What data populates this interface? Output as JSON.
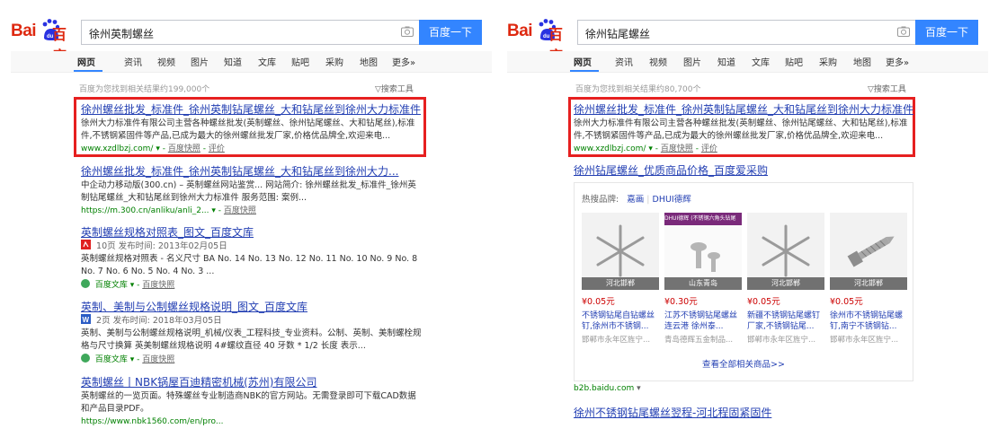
{
  "left": {
    "logo": {
      "text1": "Bai",
      "text2": "百度"
    },
    "search": {
      "query": "徐州英制螺丝",
      "button": "百度一下"
    },
    "nav": [
      "网页",
      "资讯",
      "视频",
      "图片",
      "知道",
      "文库",
      "贴吧",
      "采购",
      "地图",
      "更多»"
    ],
    "stats": "百度为您找到相关结果约199,000个",
    "tools": "搜索工具",
    "results": [
      {
        "title": "徐州螺丝批发_标准件_徐州英制钻尾螺丝_大和钻尾丝到徐州大力标准件",
        "desc": "徐州大力标准件有限公司主营各种螺丝批发(英制螺丝、徐州钻尾螺丝、大和钻尾丝),标准件,不锈钢紧固件等产品,已成为最大的徐州螺丝批发厂家,价格优品牌全,欢迎来电...",
        "url": "www.xzdlbzj.com/",
        "cache": "百度快照",
        "review": "评价"
      },
      {
        "title": "徐州螺丝批发_标准件_徐州英制钻尾螺丝_大和钻尾丝到徐州大力...",
        "desc": "中企动力移动版(300.cn) – 英制螺丝网站鉴赏... 网站简介: 徐州螺丝批发_标准件_徐州英制钻尾螺丝_大和钻尾丝到徐州大力标准件 服务范围: 案例...",
        "url": "https://m.300.cn/anliku/anli_2...",
        "cache": "百度快照"
      },
      {
        "title": "英制螺丝规格对照表_图文_百度文库",
        "meta": "10页 发布时间: 2013年02月05日",
        "desc": "英制螺丝规格对照表 - 名义尺寸 BA No. 14 No. 13 No. 12 No. 11 No. 10 No. 9 No. 8 No. 7 No. 6 No. 5 No. 4 No. 3 ...",
        "url": "百度文库",
        "cache": "百度快照"
      },
      {
        "title": "英制、美制与公制螺丝规格说明_图文_百度文库",
        "meta": "2页 发布时间: 2018年03月05日",
        "desc": "英制、美制与公制螺丝规格说明_机械/仪表_工程科技_专业资料。公制、英制、美制螺栓规格与尺寸换算 英美制螺丝规格说明 4#螺纹直径 40 牙数 * 1/2 长度 表示...",
        "url": "百度文库",
        "cache": "百度快照"
      },
      {
        "title": "英制螺丝丨NBK锅屋百迪精密机械(苏州)有限公司",
        "desc": "英制螺丝的一览页面。特殊螺丝专业制造商NBK的官方网站。无需登录即可下载CAD数据和产品目录PDF。",
        "url": "https://www.nbk1560.com/en/pro..."
      }
    ]
  },
  "right": {
    "logo": {
      "text1": "Bai",
      "text2": "百度"
    },
    "search": {
      "query": "徐州钻尾螺丝",
      "button": "百度一下"
    },
    "nav": [
      "网页",
      "资讯",
      "视频",
      "图片",
      "知道",
      "文库",
      "贴吧",
      "采购",
      "地图",
      "更多»"
    ],
    "stats": "百度为您找到相关结果约80,700个",
    "tools": "搜索工具",
    "result1": {
      "title": "徐州螺丝批发_标准件_徐州英制钻尾螺丝_大和钻尾丝到徐州大力标准件",
      "desc": "徐州大力标准件有限公司主营各种螺丝批发(英制螺丝、徐州钻尾螺丝、大和钻尾丝),标准件,不锈钢紧固件等产品,已成为最大的徐州螺丝批发厂家,价格优品牌全,欢迎来电...",
      "url": "www.xzdlbzj.com/",
      "cache": "百度快照",
      "review": "评价"
    },
    "ad": {
      "title": "徐州钻尾螺丝_优质商品价格_百度爱采购",
      "hot_label": "热搜品牌:",
      "brands": [
        "嘉画",
        "DHUI德辉"
      ],
      "products": [
        {
          "caption": "河北邯郸",
          "price": "¥0.05元",
          "title": "不锈钢钻尾自钻螺丝钉,徐州市不锈钢...",
          "seller": "邯郸市永年区旌宁..."
        },
        {
          "caption": "山东青岛",
          "price": "¥0.30元",
          "title": "江苏不锈钢钻尾螺丝连云港 徐州泰...",
          "seller": "青岛德辉五金制品..."
        },
        {
          "caption": "河北邯郸",
          "price": "¥0.05元",
          "title": "新疆不锈钢钻尾螺钉厂家,不锈钢钻尾...",
          "seller": "邯郸市永年区旌宁..."
        },
        {
          "caption": "河北邯郸",
          "price": "¥0.05元",
          "title": "徐州市不锈钢钻尾螺钉,南宁不锈钢钻...",
          "seller": "邯郸市永年区旌宁..."
        }
      ],
      "product2_banner": "DHUI德辉 (不锈钢六角头钻尾",
      "view_all": "查看全部相关商品>>",
      "source": "b2b.baidu.com"
    },
    "result3_title": "徐州不锈钢钻尾螺丝翌程-河北程固紧固件"
  },
  "colors": {
    "accent": "#3385ff",
    "highlight": "#e62020",
    "link": "#2440b3",
    "url": "#008000",
    "keyword": "#cc0000"
  }
}
